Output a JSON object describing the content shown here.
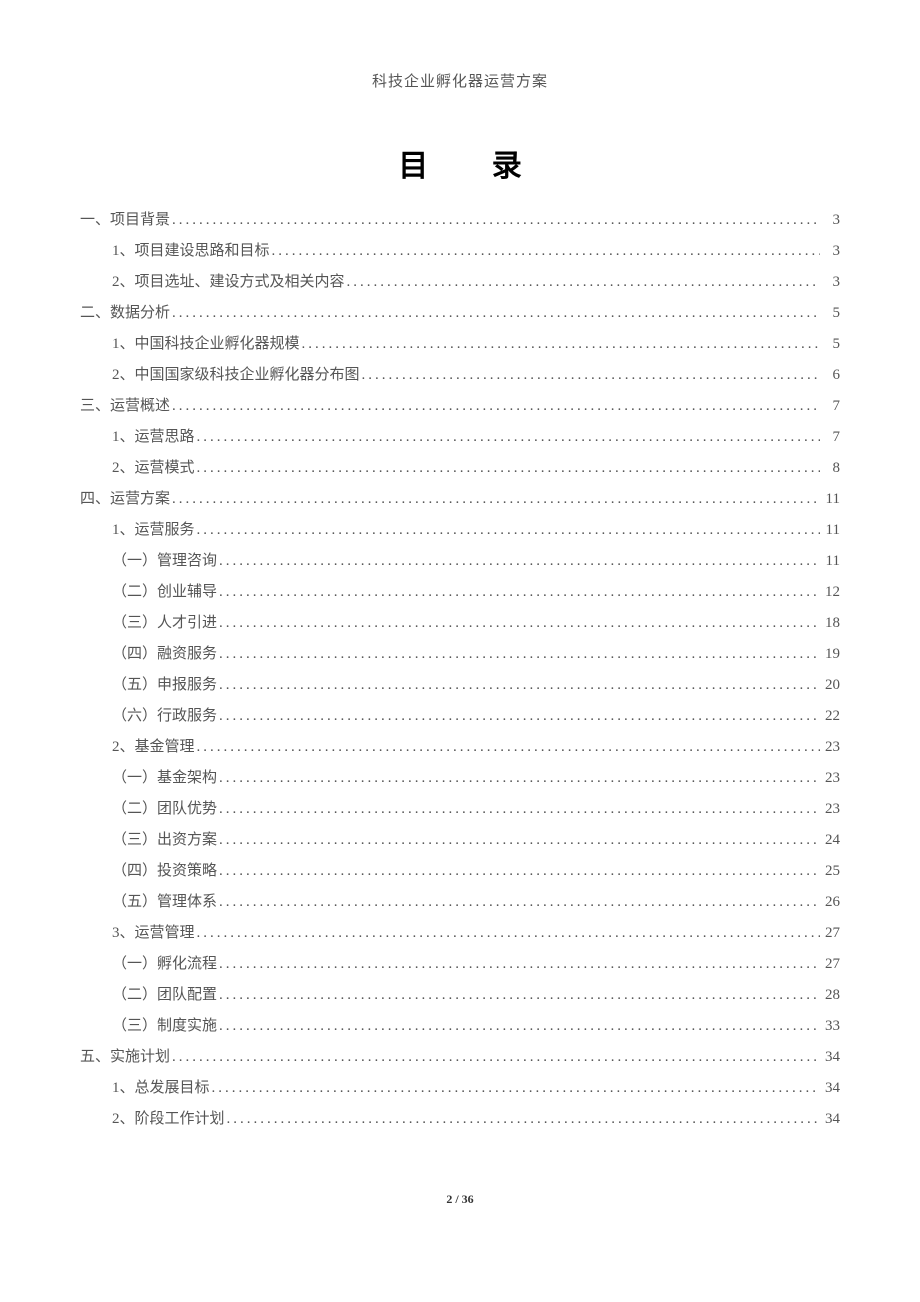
{
  "header": "科技企业孵化器运营方案",
  "title": "目 录",
  "toc": [
    {
      "level": 1,
      "label": "一、项目背景",
      "page": "3"
    },
    {
      "level": 2,
      "label": "1、项目建设思路和目标 ",
      "page": "3"
    },
    {
      "level": 2,
      "label": "2、项目选址、建设方式及相关内容 ",
      "page": "3"
    },
    {
      "level": 1,
      "label": "二、数据分析",
      "page": "5"
    },
    {
      "level": 2,
      "label": "1、中国科技企业孵化器规模 ",
      "page": "5"
    },
    {
      "level": 2,
      "label": "2、中国国家级科技企业孵化器分布图 ",
      "page": "6"
    },
    {
      "level": 1,
      "label": "三、运营概述",
      "page": "7"
    },
    {
      "level": 2,
      "label": "1、运营思路 ",
      "page": "7"
    },
    {
      "level": 2,
      "label": "2、运营模式 ",
      "page": "8"
    },
    {
      "level": 1,
      "label": "四、运营方案",
      "page": "11"
    },
    {
      "level": 2,
      "label": "1、运营服务 ",
      "page": "11"
    },
    {
      "level": 3,
      "label": "（一）管理咨询",
      "page": "11"
    },
    {
      "level": 3,
      "label": "（二）创业辅导",
      "page": "12"
    },
    {
      "level": 3,
      "label": "（三）人才引进",
      "page": "18"
    },
    {
      "level": 3,
      "label": "（四）融资服务",
      "page": "19"
    },
    {
      "level": 3,
      "label": "（五）申报服务",
      "page": "20"
    },
    {
      "level": 3,
      "label": "（六）行政服务",
      "page": "22"
    },
    {
      "level": 2,
      "label": "2、基金管理 ",
      "page": "23"
    },
    {
      "level": 3,
      "label": "（一）基金架构",
      "page": "23"
    },
    {
      "level": 3,
      "label": "（二）团队优势",
      "page": "23"
    },
    {
      "level": 3,
      "label": "（三）出资方案",
      "page": "24"
    },
    {
      "level": 3,
      "label": "（四）投资策略",
      "page": "25"
    },
    {
      "level": 3,
      "label": "（五）管理体系",
      "page": "26"
    },
    {
      "level": 2,
      "label": "3、运营管理 ",
      "page": "27"
    },
    {
      "level": 3,
      "label": "（一）孵化流程",
      "page": "27"
    },
    {
      "level": 3,
      "label": "（二）团队配置",
      "page": "28"
    },
    {
      "level": 3,
      "label": "（三）制度实施",
      "page": "33"
    },
    {
      "level": 1,
      "label": "五、实施计划",
      "page": "34"
    },
    {
      "level": 2,
      "label": "1、总发展目标 ",
      "page": "34"
    },
    {
      "level": 2,
      "label": "2、阶段工作计划 ",
      "page": "34"
    }
  ],
  "footer": "2 / 36"
}
